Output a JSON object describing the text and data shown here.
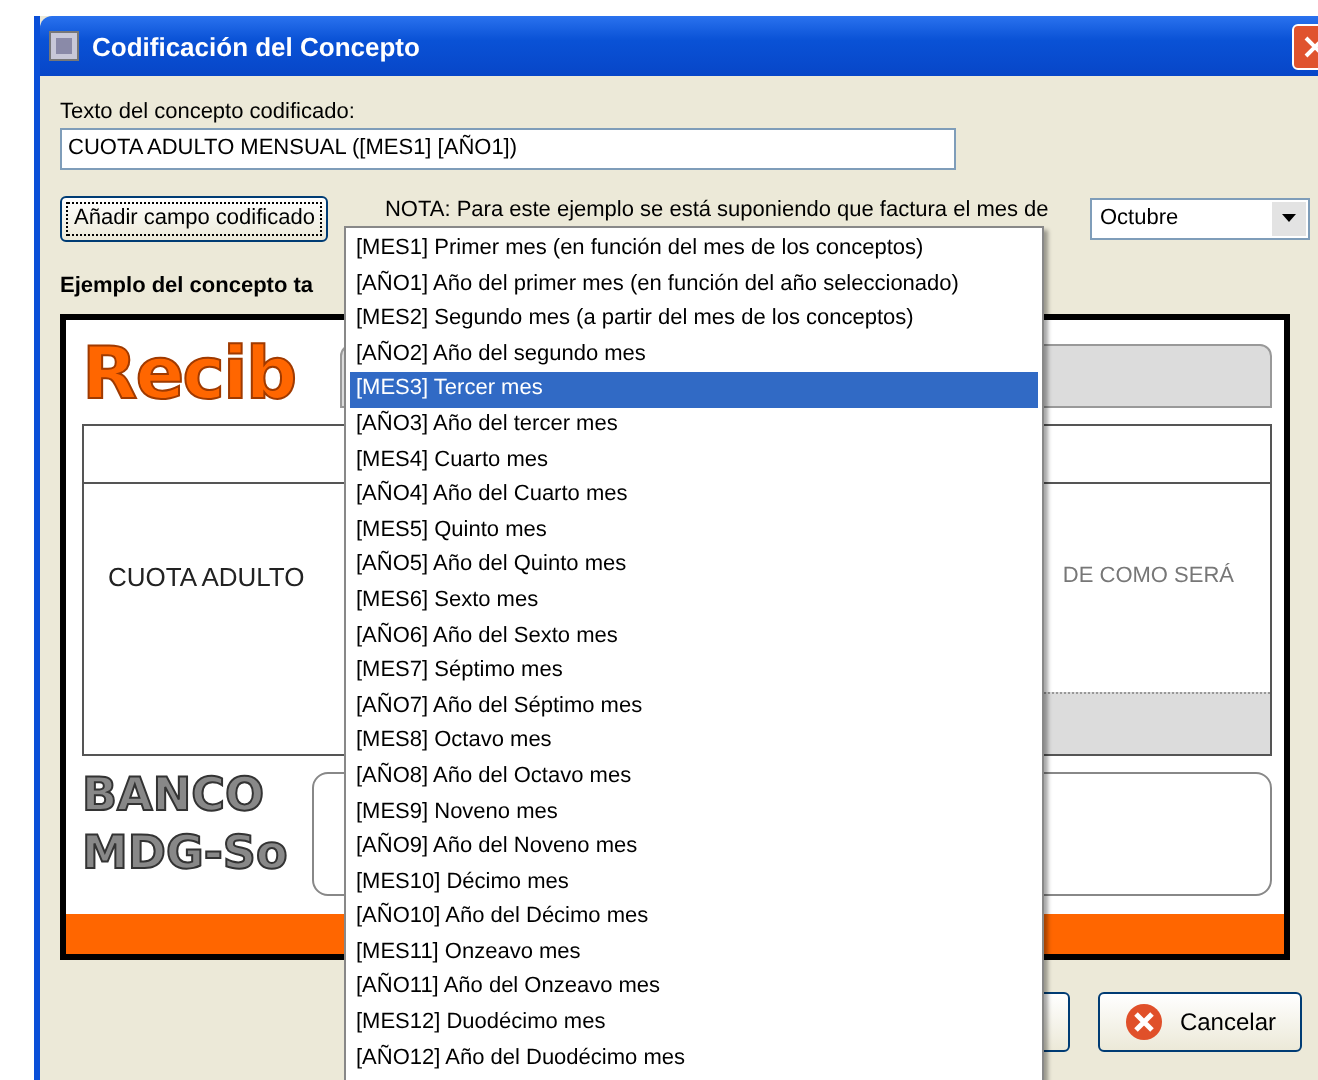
{
  "window": {
    "title": "Codificación del Concepto"
  },
  "concept_field": {
    "label": "Texto del concepto codificado:",
    "value": "CUOTA ADULTO MENSUAL ([MES1] [AÑO1])"
  },
  "add_button": "Añadir campo codificado",
  "note": "NOTA: Para este ejemplo se está suponiendo que factura el mes de",
  "month_select": {
    "value": "Octubre"
  },
  "example_heading": "Ejemplo del concepto ta",
  "preview": {
    "logo": "Recib",
    "concept": "CUOTA ADULTO",
    "right_text": "DE COMO SERÁ",
    "bank_lines": [
      "BANCO",
      "MDG-So"
    ]
  },
  "cancel_button": "Cancelar",
  "menu": {
    "items": [
      {
        "label": "[MES1] Primer mes (en función del mes de los conceptos)",
        "selected": false
      },
      {
        "label": "[AÑO1] Año del primer mes (en función del año seleccionado)",
        "selected": false
      },
      {
        "label": "[MES2] Segundo mes (a partir del mes de los conceptos)",
        "selected": false
      },
      {
        "label": "[AÑO2] Año del segundo mes",
        "selected": false
      },
      {
        "label": "[MES3] Tercer mes",
        "selected": true
      },
      {
        "label": "[AÑO3] Año del tercer mes",
        "selected": false
      },
      {
        "label": "[MES4] Cuarto mes",
        "selected": false
      },
      {
        "label": "[AÑO4] Año del Cuarto mes",
        "selected": false
      },
      {
        "label": "[MES5] Quinto mes",
        "selected": false
      },
      {
        "label": "[AÑO5] Año del Quinto mes",
        "selected": false
      },
      {
        "label": "[MES6] Sexto mes",
        "selected": false
      },
      {
        "label": "[AÑO6] Año del Sexto mes",
        "selected": false
      },
      {
        "label": "[MES7] Séptimo mes",
        "selected": false
      },
      {
        "label": "[AÑO7] Año del Séptimo mes",
        "selected": false
      },
      {
        "label": "[MES8] Octavo mes",
        "selected": false
      },
      {
        "label": "[AÑO8] Año del Octavo mes",
        "selected": false
      },
      {
        "label": "[MES9] Noveno mes",
        "selected": false
      },
      {
        "label": "[AÑO9] Año del Noveno mes",
        "selected": false
      },
      {
        "label": "[MES10] Décimo mes",
        "selected": false
      },
      {
        "label": "[AÑO10] Año del Décimo mes",
        "selected": false
      },
      {
        "label": "[MES11] Onzeavo mes",
        "selected": false
      },
      {
        "label": "[AÑO11] Año del Onzeavo mes",
        "selected": false
      },
      {
        "label": "[MES12] Duodécimo mes",
        "selected": false
      },
      {
        "label": "[AÑO12] Año del Duodécimo mes",
        "selected": false
      }
    ]
  }
}
